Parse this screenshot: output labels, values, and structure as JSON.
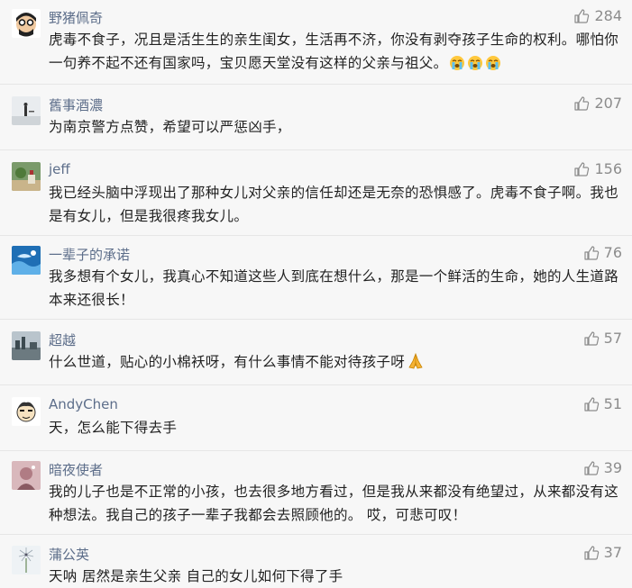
{
  "comments": [
    {
      "username": "野猪佩奇",
      "likes": "284",
      "text": "虎毒不食子，况且是活生生的亲生闺女，生活再不济，你没有剥夺孩子生命的权利。哪怕你一句养不起不还有国家吗，宝贝愿天堂没有这样的父亲与祖父。",
      "emojis": [
        "crying-face",
        "crying-face",
        "crying-face"
      ]
    },
    {
      "username": "舊事酒濃",
      "likes": "207",
      "text": "为南京警方点赞，希望可以严惩凶手，"
    },
    {
      "username": "jeff",
      "likes": "156",
      "text": "我已经头脑中浮现出了那种女儿对父亲的信任却还是无奈的恐惧感了。虎毒不食子啊。我也是有女儿，但是我很疼我女儿。"
    },
    {
      "username": "一辈子的承诺",
      "likes": "76",
      "text": "我多想有个女儿，我真心不知道这些人到底在想什么，那是一个鲜活的生命，她的人生道路本来还很长！"
    },
    {
      "username": "超越",
      "likes": "57",
      "text": "什么世道，贴心的小棉袄呀，有什么事情不能对待孩子呀",
      "emojis": [
        "praying-hands"
      ]
    },
    {
      "username": "AndyChen",
      "likes": "51",
      "text": "天，怎么能下得去手"
    },
    {
      "username": "暗夜使者",
      "likes": "39",
      "text": "我的儿子也是不正常的小孩，也去很多地方看过，但是我从来都没有绝望过，从来都没有这种想法。我自己的孩子一辈子我都会去照顾他的。 哎，可悲可叹！"
    },
    {
      "username": "蒲公英",
      "likes": "37",
      "text": "天呐 居然是亲生父亲 自己的女儿如何下得了手"
    }
  ],
  "icons": {
    "like": "thumbs-up-icon"
  },
  "colors": {
    "username": "#5d6e8a",
    "likes": "#8c8c8c",
    "text": "#222222",
    "background": "#f7f7f7"
  }
}
